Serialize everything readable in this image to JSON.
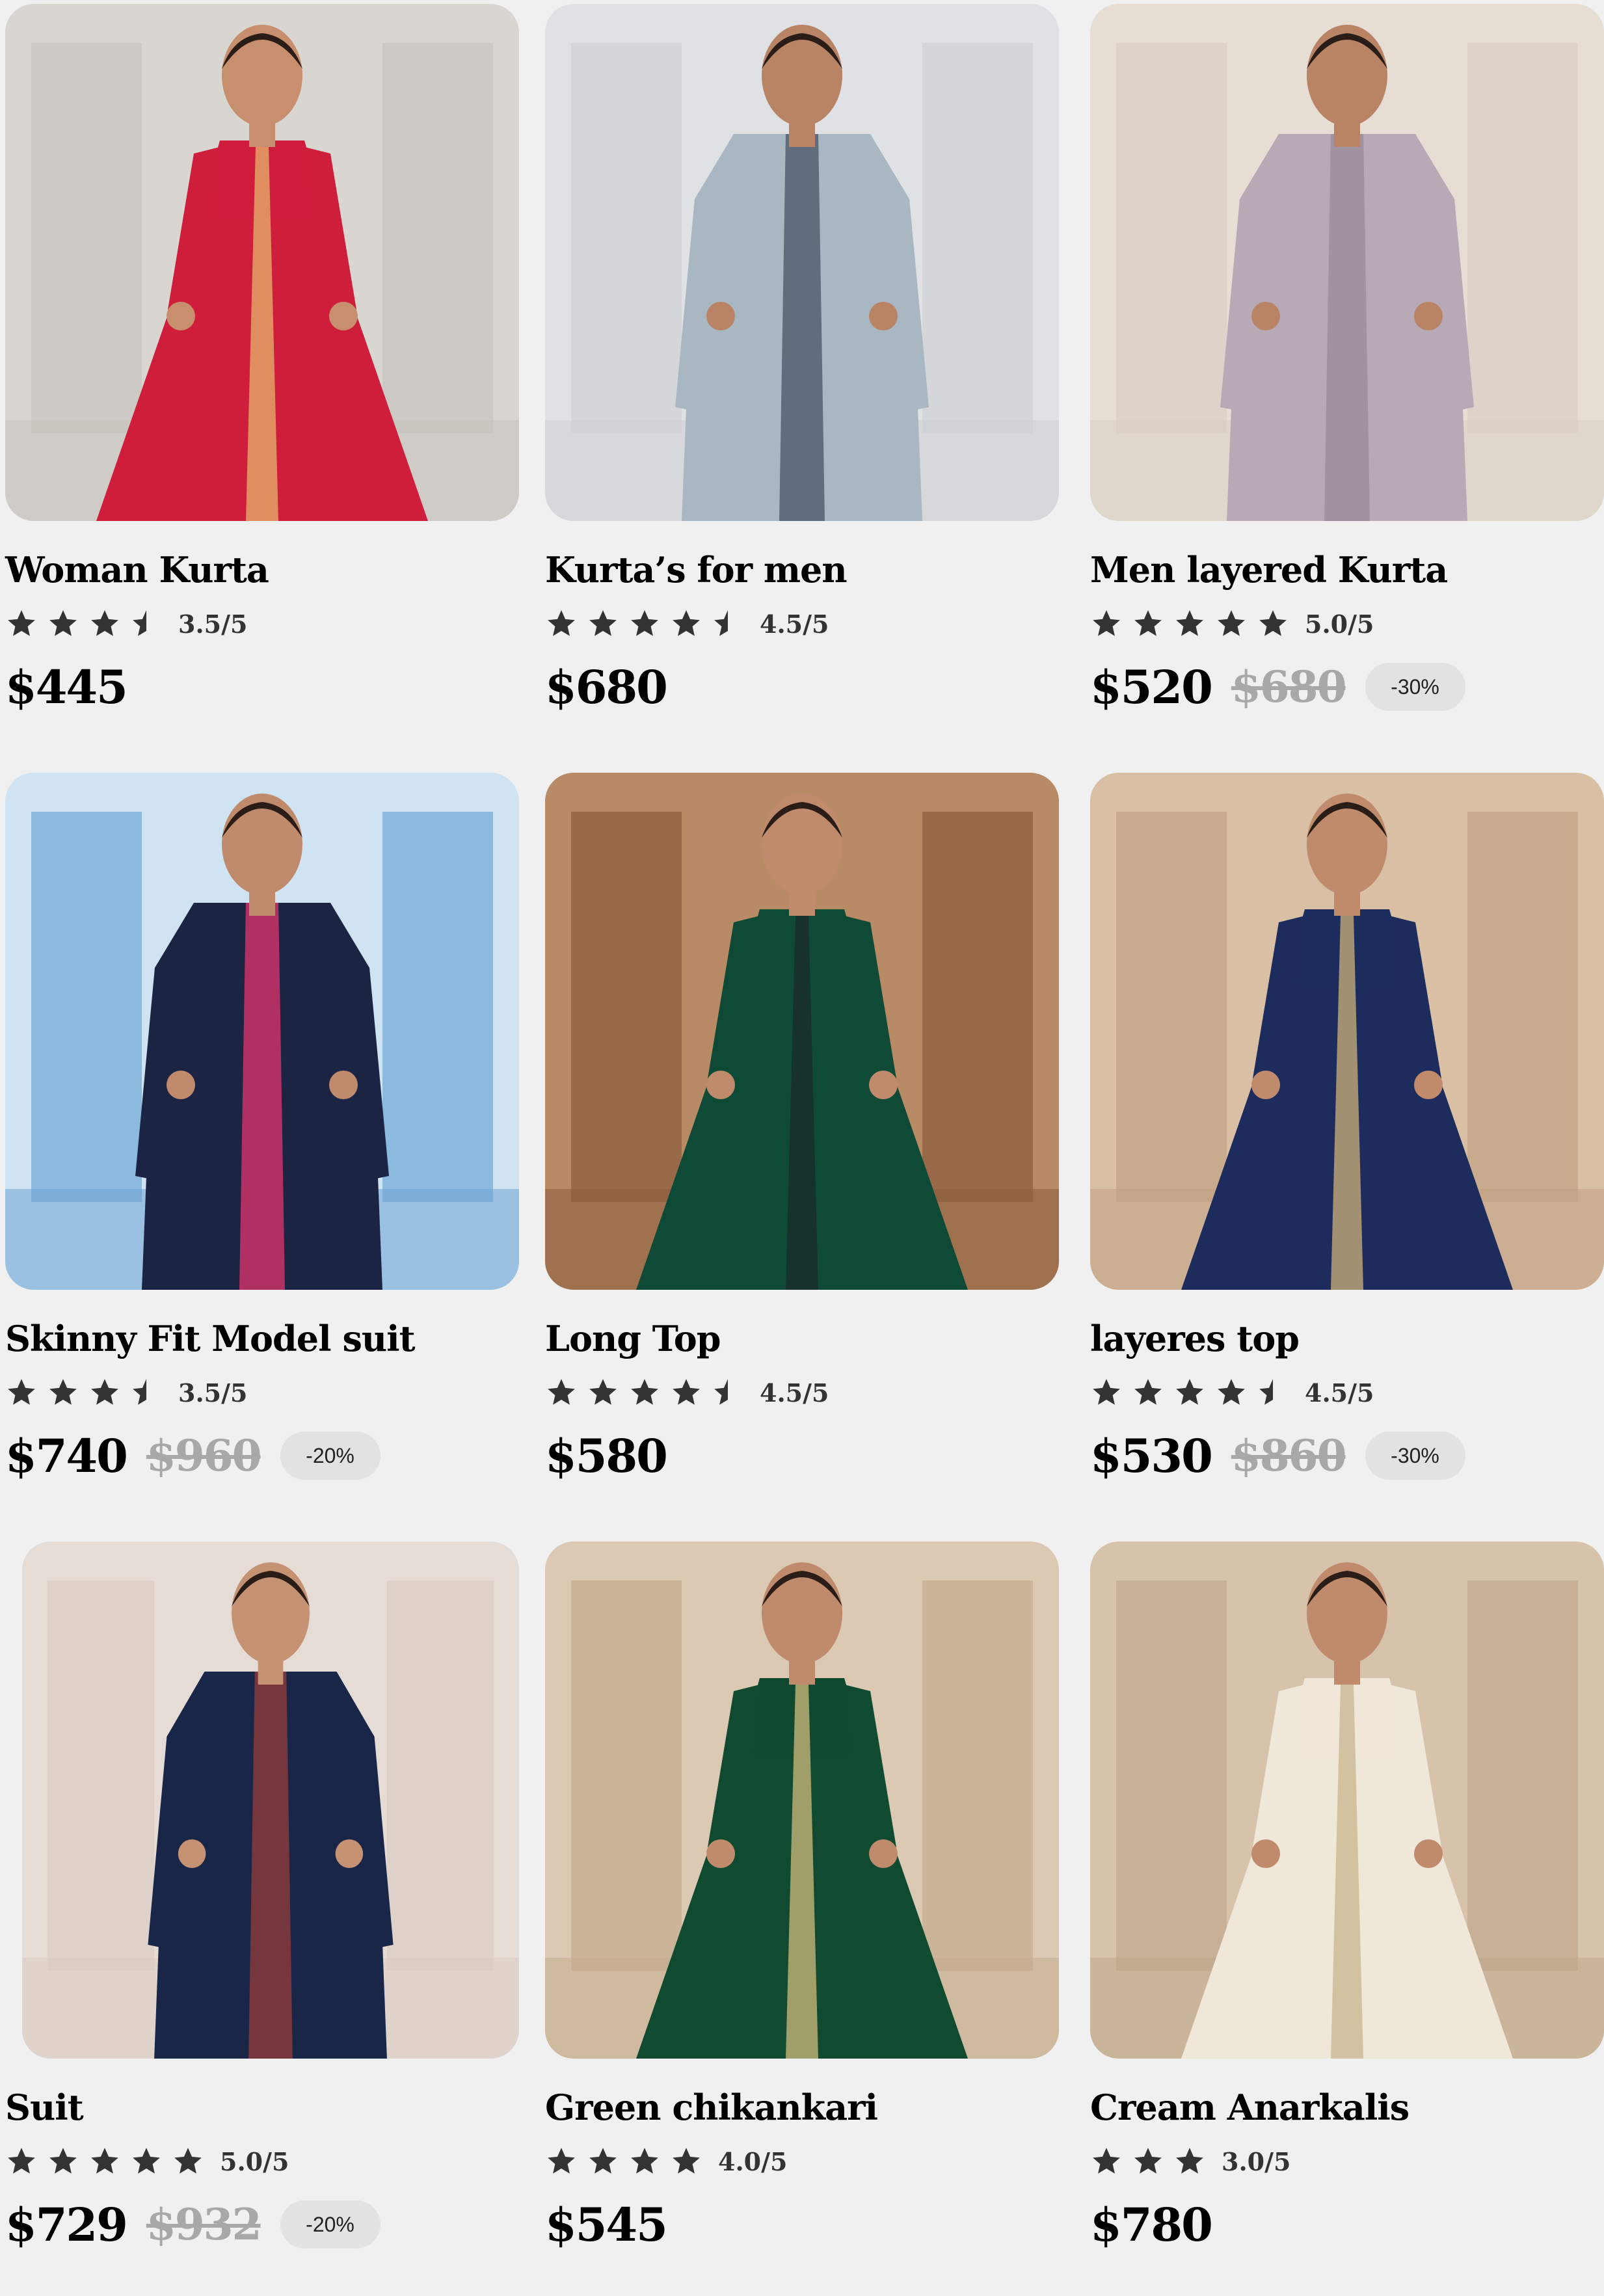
{
  "products": [
    {
      "title": "Woman Kurta",
      "rating": 3.5,
      "rating_text": "3.5/5",
      "price": "$445",
      "old_price": "",
      "discount": "",
      "palette": {
        "bg": "#d9d6d2",
        "bg2": "#c7c3bd",
        "main": "#cf1d3c",
        "accent": "#e6b36b",
        "skin": "#c78f6d"
      }
    },
    {
      "title": "Kurta’s for men",
      "rating": 4.5,
      "rating_text": "4.5/5",
      "price": "$680",
      "old_price": "",
      "discount": "",
      "palette": {
        "bg": "#dfe1e4",
        "bg2": "#cfd2d6",
        "main": "#a9b7c2",
        "accent": "#4f5a6b",
        "skin": "#b98466"
      }
    },
    {
      "title": "Men layered Kurta",
      "rating": 5.0,
      "rating_text": "5.0/5",
      "price": "$520",
      "old_price": "$680",
      "discount": "-30%",
      "palette": {
        "bg": "#e6ded5",
        "bg2": "#d8cfc4",
        "main": "#b7a9b6",
        "accent": "#9b8c9d",
        "skin": "#b98466"
      }
    },
    {
      "title": "Skinny Fit Model suit",
      "rating": 3.5,
      "rating_text": "3.5/5",
      "price": "$740",
      "old_price": "$960",
      "discount": "-20%",
      "palette": {
        "bg": "#cfe3f2",
        "bg2": "#6fa6d6",
        "main": "#1c2444",
        "accent": "#d6336c",
        "skin": "#c08b6c"
      }
    },
    {
      "title": "Long Top",
      "rating": 4.5,
      "rating_text": "4.5/5",
      "price": "$580",
      "old_price": "",
      "discount": "",
      "palette": {
        "bg": "#b88a65",
        "bg2": "#8a5c3d",
        "main": "#0f4a36",
        "accent": "#1b2b2b",
        "skin": "#c08b6c"
      }
    },
    {
      "title": "layeres  top",
      "rating": 4.5,
      "rating_text": "4.5/5",
      "price": "$530",
      "old_price": "$860",
      "discount": "-30%",
      "palette": {
        "bg": "#d9c0a4",
        "bg2": "#c1a183",
        "main": "#1d2c5c",
        "accent": "#cdb27a",
        "skin": "#c08b6c"
      }
    },
    {
      "title": "Suit",
      "rating": 5.0,
      "rating_text": "5.0/5",
      "price": "$729",
      "old_price": "$932",
      "discount": "-20%",
      "palette": {
        "bg": "#e6dcd6",
        "bg2": "#d8ccc4",
        "main": "#1a2648",
        "accent": "#8c3b3b",
        "skin": "#c69274"
      }
    },
    {
      "title": "Green chikankari",
      "rating": 4.0,
      "rating_text": "4.0/5",
      "price": "$545",
      "old_price": "",
      "discount": "",
      "palette": {
        "bg": "#dcc9b3",
        "bg2": "#c5ab8e",
        "main": "#0f4a31",
        "accent": "#d2bb7c",
        "skin": "#c08b6c"
      }
    },
    {
      "title": "Cream  Anarkalis",
      "rating": 3.0,
      "rating_text": "3.0/5",
      "price": "$780",
      "old_price": "",
      "discount": "",
      "palette": {
        "bg": "#d7c3ac",
        "bg2": "#c0a88c",
        "main": "#efe7d8",
        "accent": "#c9b58c",
        "skin": "#c08b6c"
      }
    }
  ]
}
